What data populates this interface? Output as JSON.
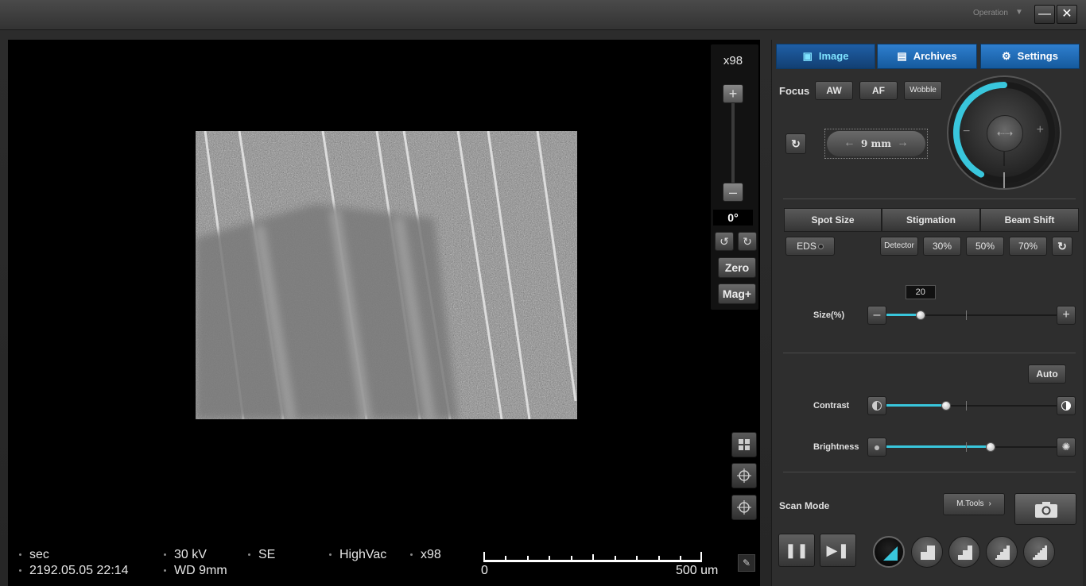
{
  "titlebar": {
    "operation_label": "Operation",
    "operation_arrow": "▼",
    "minimize_glyph": "—",
    "close_glyph": "✕"
  },
  "viewer": {
    "magnification": "x98",
    "rotation_angle": "0°",
    "zoom_plus_glyph": "+",
    "zoom_minus_glyph": "–",
    "rotate_ccw_glyph": "↺",
    "rotate_cw_glyph": "↻",
    "zero_label": "Zero",
    "magplus_label": "Mag+"
  },
  "status": {
    "scan_time": "sec",
    "datetime": "2192.05.05 22:14",
    "voltage": "30 kV",
    "working_distance": "WD 9mm",
    "detector": "SE",
    "vacuum": "HighVac",
    "magnification": "x98",
    "scale_min": "0",
    "scale_max": "500 um"
  },
  "tabs": [
    {
      "label": "Image",
      "icon": "image-icon"
    },
    {
      "label": "Archives",
      "icon": "archive-icon"
    },
    {
      "label": "Settings",
      "icon": "gear-icon"
    }
  ],
  "focus": {
    "label": "Focus",
    "aw_label": "AW",
    "af_label": "AF",
    "wobble_label": "Wobble",
    "wd_value": "9 mm",
    "wd_left_glyph": "⇠",
    "wd_right_glyph": "⇢",
    "knob_minus": "−",
    "knob_plus": "+",
    "knob_center_glyph": "⇠⇢",
    "knob_level": 0.42,
    "accent_color": "#39c6dc"
  },
  "beam": {
    "segments": [
      "Spot Size",
      "Stigmation",
      "Beam Shift"
    ],
    "eds_label": "EDS",
    "detector_label": "Detector",
    "presets": [
      "30%",
      "50%",
      "70%"
    ],
    "size_label": "Size(%)",
    "size_value": "20",
    "size_percent": 20
  },
  "image_adjust": {
    "auto_label": "Auto",
    "contrast_label": "Contrast",
    "contrast_value": 35,
    "brightness_label": "Brightness",
    "brightness_value": 61
  },
  "scan": {
    "label": "Scan Mode",
    "mtools_label": "M.Tools",
    "pause_glyph": "❚❚",
    "step_glyph": "▶❚"
  }
}
